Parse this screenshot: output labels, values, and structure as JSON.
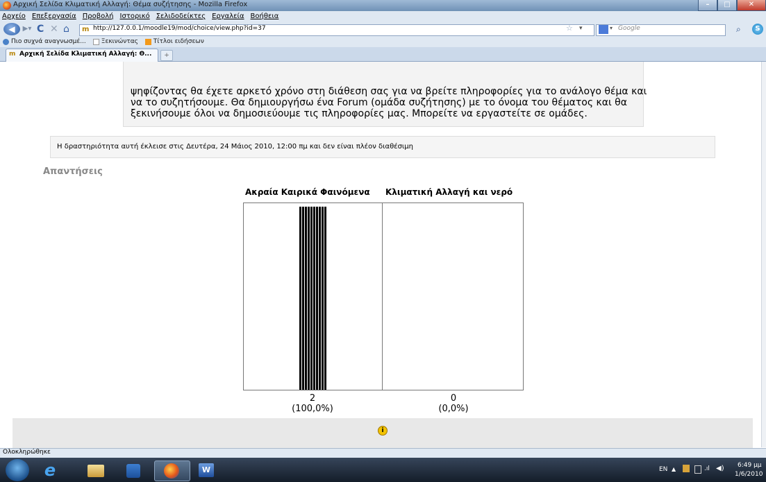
{
  "window": {
    "title": "Αρχική Σελίδα Κλιματική Αλλαγή: Θέμα συζήτησης - Mozilla Firefox"
  },
  "menu": [
    "Αρχείο",
    "Επεξεργασία",
    "Προβολή",
    "Ιστορικό",
    "Σελιδοδείκτες",
    "Εργαλεία",
    "Βοήθεια"
  ],
  "nav": {
    "url": "http://127.0.0.1/moodle19/mod/choice/view.php?id=37",
    "search_placeholder": "Google"
  },
  "bookmarks": [
    "Πιο συχνά αναγνωσμέ...",
    "Ξεκινώντας",
    "Τίτλοι ειδήσεων"
  ],
  "tab": {
    "title": "Αρχική Σελίδα Κλιματική Αλλαγή: Θ..."
  },
  "intro": {
    "lines": [
      "ψηφίζοντας θα έχετε αρκετό χρόνο στη διάθεση σας για να βρείτε πληροφορίες για το ανάλογο θέμα και",
      "να το συζητήσουμε. Θα δημιουργήσω ένα Forum (ομάδα συζήτησης) με το όνομα του θέματος και θα",
      "ξεκινήσουμε όλοι να δημοσιεύουμε τις πληροφορίες μας. Μπορείτε να εργαστείτε σε ομάδες."
    ]
  },
  "notice": "Η δραστηριότητα αυτή έκλεισε στις Δευτέρα, 24 Μάιος 2010, 12:00 πμ και δεν είναι πλέον διαθέσιμη",
  "answers_heading": "Απαντήσεις",
  "chart_data": {
    "type": "bar",
    "categories": [
      "Ακραία Καιρικά Φαινόμενα",
      "Κλιματική Αλλαγή και νερό"
    ],
    "values": [
      2,
      0
    ],
    "percent_labels": [
      "(100,0%)",
      "(0,0%)"
    ]
  },
  "status": "Ολοκληρώθηκε",
  "taskbar": {
    "lang": "EN",
    "time": "6:49 μμ",
    "date": "1/6/2010"
  }
}
